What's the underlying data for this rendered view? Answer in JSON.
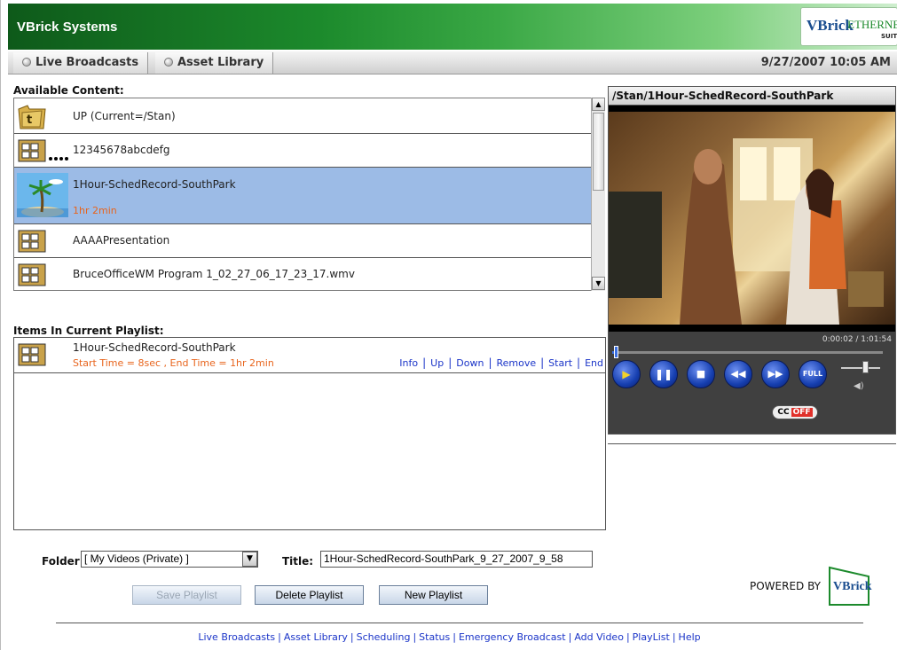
{
  "header": {
    "title": "VBrick Systems",
    "logo": {
      "vbrick": "VBrick",
      "ethernet": "ETHERNETV",
      "suite": "SUITE"
    },
    "colors": {
      "header_dark": "#0e5a1a",
      "header_light": "#cfeecf"
    }
  },
  "tabs": {
    "live": "Live Broadcasts",
    "asset": "Asset Library"
  },
  "datetime": "9/27/2007 10:05 AM",
  "available": {
    "label": "Available Content:",
    "items": [
      {
        "name": "UP (Current=/Stan)",
        "icon": "folder-up-icon"
      },
      {
        "name": "12345678abcdefg",
        "icon": "filmstrip-icon"
      },
      {
        "name": "1Hour-SchedRecord-SouthPark",
        "sub": "1hr 2min",
        "icon": "beach-thumbnail-icon"
      },
      {
        "name": "AAAAPresentation",
        "icon": "filmstrip-icon"
      },
      {
        "name": "BruceOfficeWM Program 1_02_27_06_17_23_17.wmv",
        "icon": "filmstrip-icon"
      }
    ],
    "selected_color": "#9cbbe6"
  },
  "playlist": {
    "label": "Items In Current Playlist:",
    "item": {
      "name": "1Hour-SchedRecord-SouthPark",
      "times": "Start Time = 8sec , End Time = 1hr 2min"
    },
    "actions": [
      "Info",
      "Up",
      "Down",
      "Remove",
      "Start",
      "End"
    ]
  },
  "video": {
    "title": "/Stan/1Hour-SchedRecord-SouthPark",
    "time": "0:00:02 / 1:01:54",
    "progress": 0.01,
    "buttons": {
      "full": "FULL",
      "cc": "CC",
      "cc_state": "OFF"
    }
  },
  "form": {
    "folder_label": "Folder:",
    "folder_value": "[ My Videos (Private) ]",
    "title_label": "Title:",
    "title_value": "1Hour-SchedRecord-SouthPark_9_27_2007_9_58",
    "save": "Save Playlist",
    "delete": "Delete Playlist",
    "new": "New Playlist"
  },
  "powered": {
    "text": "POWERED BY",
    "brand": "VBrick"
  },
  "footer": [
    "Live Broadcasts",
    "Asset Library",
    "Scheduling",
    "Status",
    "Emergency Broadcast",
    "Add Video",
    "PlayList",
    "Help"
  ]
}
